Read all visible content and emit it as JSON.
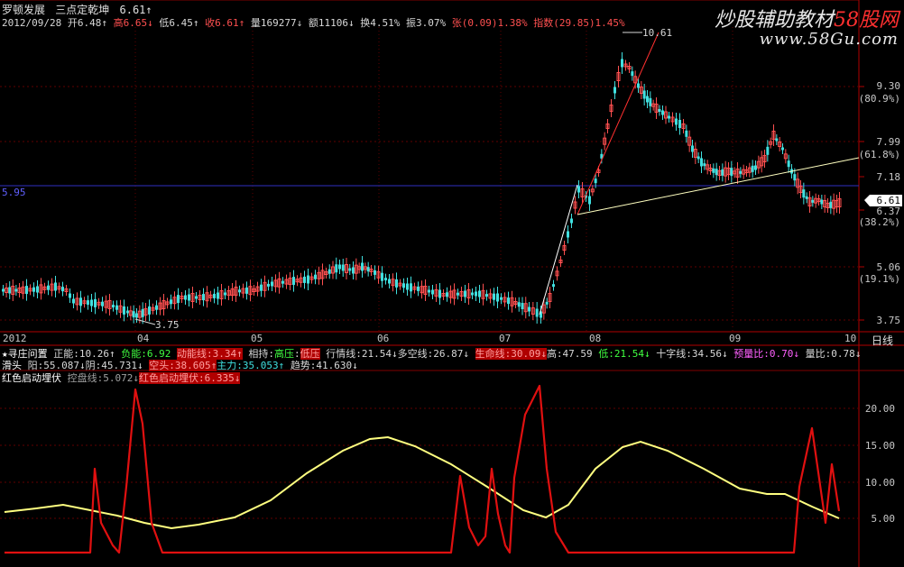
{
  "header": {
    "stock_name": "罗顿发展",
    "indicator_title": "三点定乾坤",
    "last_price": "6.61",
    "last_arrow": "↑"
  },
  "quote": {
    "date": "2012/09/28",
    "open": "开6.48↑",
    "high": "高6.65↓",
    "low": "低6.45↑",
    "close": "收6.61↑",
    "volume": "量169277↓",
    "amount": "额11106↓",
    "turnover": "换4.51%",
    "amplitude": "振3.07%",
    "change": "张(0.09)1.38%",
    "index": "指数(29.85)1.45%"
  },
  "watermark": {
    "line1_prefix": "炒股辅助教材",
    "line1_accent": "58股网",
    "line2": "www.58Gu.com"
  },
  "price_axis": {
    "labels": [
      "9.30",
      "(80.9%)",
      "7.99",
      "(61.8%)",
      "7.18",
      "6.61",
      "6.37",
      "(38.2%)",
      "5.06",
      "(19.1%)",
      "3.75"
    ],
    "current": "6.61",
    "left_line_label": "5.95",
    "high_label": "10.61",
    "low_label": "3.75"
  },
  "date_axis": {
    "labels": [
      "2012",
      "04",
      "05",
      "06",
      "07",
      "08",
      "09",
      "10"
    ],
    "period": "日线"
  },
  "indicator": {
    "row1": {
      "title": "★寻庄问置",
      "zhengneng": "正能:10.26↑",
      "funeng": "负能:6.92",
      "dongneng": "动能线:3.34↑",
      "xiangchi": "相持:",
      "gaoya": "高压",
      "dizhi": "低压",
      "hangqing": "行情线:21.54↓",
      "duokong": "多空线:26.87↓",
      "shengming": "生命线:30.09↓",
      "gao": "高:47.59",
      "di": "低:21.54↓",
      "shizi": "十字线:34.56↓",
      "yuliang": "预量比:0.70↓",
      "liangbi": "量比:0.78↓"
    },
    "row2": {
      "title": "滑头",
      "yang": "阳:55.087↓",
      "yin": "阴:45.731↓",
      "kongtou": "空头:38.605↑",
      "zhuli": "主力:35.053↑",
      "qushi": "趋势:41.630↓"
    },
    "row3": {
      "title": "红色启动埋伏",
      "kongpan": "控盘线:5.072↓",
      "qidong": "红色启动埋伏:6.335↓"
    },
    "axis_labels": [
      "20.00",
      "15.00",
      "10.00",
      "5.00"
    ]
  },
  "colors": {
    "up": "#ff5050",
    "down": "#40e0e0",
    "control_line_up": "#ffff80",
    "control_line_down": "#a0a0a0",
    "signal_line": "#e01010"
  }
}
